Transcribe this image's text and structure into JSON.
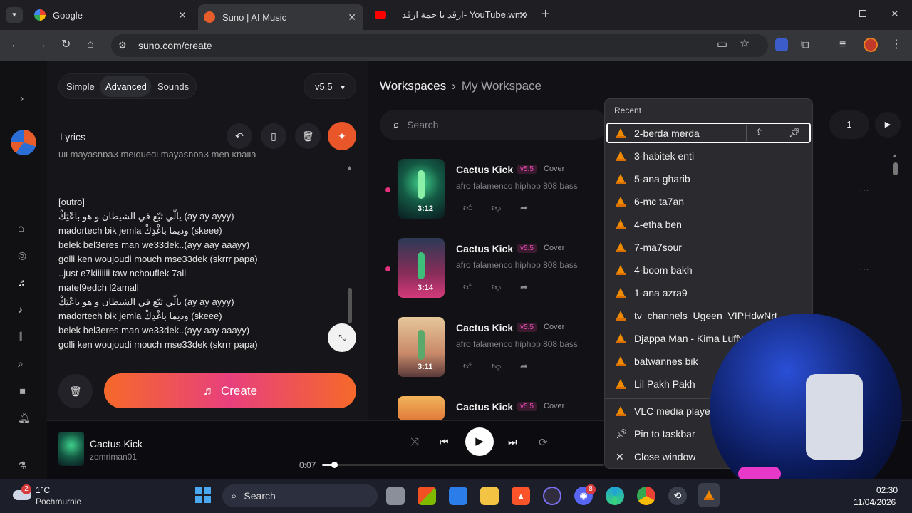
{
  "browser": {
    "tabs": [
      {
        "title": "Google",
        "icon": "google-icon"
      },
      {
        "title": "Suno | AI Music",
        "icon": "suno-icon"
      },
      {
        "title": "ارقد يا حمة ارقد- YouTube.wmv",
        "icon": "youtube-icon"
      }
    ],
    "new_tab": "+",
    "url": "suno.com/create"
  },
  "panel": {
    "modes": [
      "Simple",
      "Advanced",
      "Sounds"
    ],
    "active_mode": "Advanced",
    "version": "v5.5",
    "lyrics_label": "Lyrics",
    "lyrics_cut": "ull mayashba3 melouedi mayashba3 men khalla",
    "lyrics_lines": [
      "[outro]",
      "يالّي تبّع في الشيطان و هو باعْتِكْ (ay ay ayyy)",
      "madortech bik jemla وديما باغْدِكْ (skeee)",
      "belek bel3eres man we33dek..(ayy aay aaayy)",
      "golli ken woujoudi mouch mse33dek (skrrr papa)",
      "..just e7kiiiiiii  taw nchouflek 7all",
      "matef9edch l2amall",
      "يالّي تبّع في الشيطان و هو باعْتِكْ (ay ay ayyy)",
      "madortech bik jemla وديما باغْدِكْ (skeee)",
      "belek bel3eres man we33dek..(ayy aay aaayy)",
      "golli ken woujoudi mouch mse33dek (skrrr papa)"
    ],
    "create_label": "Create"
  },
  "main": {
    "breadcrumb": [
      "Workspaces",
      "My Workspace"
    ],
    "search_placeholder": "Search",
    "page_number": "1",
    "songs": [
      {
        "title": "Cactus Kick",
        "version": "v5.5",
        "tag": "Cover",
        "desc": "afro falamenco hiphop 808 bass",
        "duration": "3:12"
      },
      {
        "title": "Cactus Kick",
        "version": "v5.5",
        "tag": "Cover",
        "desc": "afro falamenco hiphop 808 bass",
        "duration": "3:14"
      },
      {
        "title": "Cactus Kick",
        "version": "v5.5",
        "tag": "Cover",
        "desc": "afro falamenco hiphop 808 bass",
        "duration": "3:11"
      },
      {
        "title": "Cactus Kick",
        "version": "v5.5",
        "tag": "Cover",
        "desc": "",
        "duration": ""
      }
    ]
  },
  "jumplist": {
    "header": "Recent",
    "items": [
      "2-berda merda",
      "3-habitek enti",
      "5-ana gharib",
      "6-mc ta7an",
      "4-etha ben",
      "7-ma7sour",
      "4-boom bakh",
      "1-ana azra9",
      "tv_channels_Ugeen_VIPHdwNrt",
      "Djappa Man - Kima Luffy",
      "batwannes bik",
      "Lil Pakh Pakh"
    ],
    "app_name": "VLC media player",
    "pin_label": "Pin to taskbar",
    "close_label": "Close window"
  },
  "player": {
    "title": "Cactus Kick",
    "artist": "zomriman01",
    "time": "0:07",
    "progress": 0.04
  },
  "taskbar": {
    "weather_temp": "1°C",
    "weather_place": "Pochmurnie",
    "weather_badge": "2",
    "search": "Search",
    "time": "02:30",
    "date": "11/04/2026",
    "discord_badge": "8"
  }
}
